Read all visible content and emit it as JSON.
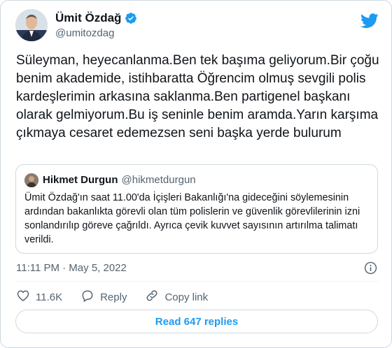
{
  "author": {
    "name": "Ümit Özdağ",
    "handle": "@umitozdag",
    "verified": true
  },
  "tweet": {
    "text": "Süleyman, heyecanlanma.Ben tek başıma geliyorum.Bir çoğu benim akademide, istihbaratta Öğrencim olmuş sevgili polis kardeşlerimin arkasına saklanma.Ben partigenel başkanı olarak gelmiyorum.Bu iş seninle benim aramda.Yarın karşıma çıkmaya cesaret edemezsen seni başka yerde bulurum",
    "timestamp": "11:11 PM · May 5, 2022"
  },
  "quoted": {
    "name": "Hikmet Durgun",
    "handle": "@hikmetdurgun",
    "text": "Ümit Özdağ'ın saat 11.00'da İçişleri Bakanlığı'na gideceğini söylemesinin ardından bakanlıkta görevli olan tüm polislerin ve güvenlik görevlilerinin izni sonlandırılıp göreve çağrıldı. Ayrıca çevik kuvvet sayısının artırılma talimatı verildi."
  },
  "actions": {
    "likes": "11.6K",
    "reply": "Reply",
    "copy_link": "Copy link"
  },
  "read_replies": "Read 647 replies",
  "colors": {
    "accent": "#1d9bf0",
    "muted": "#536471",
    "border": "#cfd9de"
  },
  "icons": [
    "verified-badge-icon",
    "twitter-bird-icon",
    "info-icon",
    "heart-icon",
    "reply-icon",
    "link-icon"
  ]
}
